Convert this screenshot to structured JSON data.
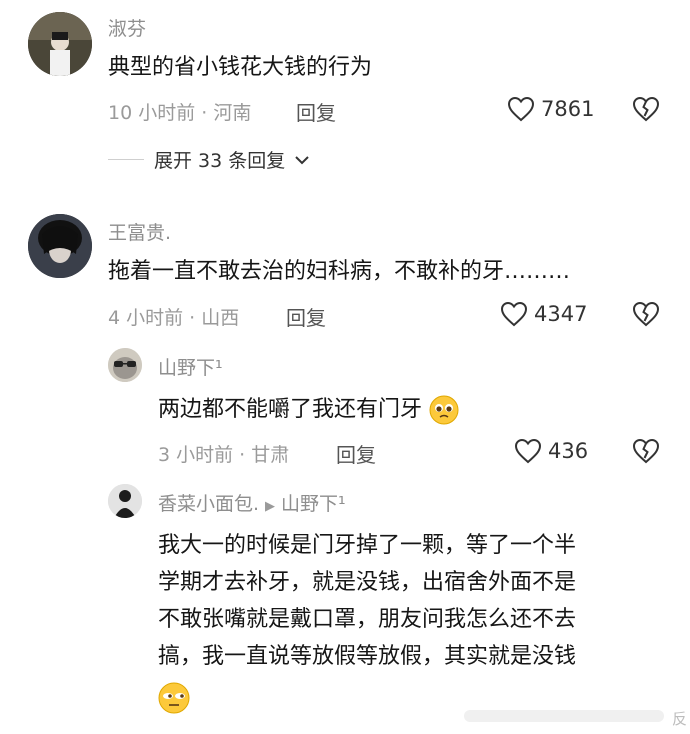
{
  "comments": [
    {
      "username": "淑芬",
      "text": "典型的省小钱花大钱的行为",
      "meta": "10 小时前 · 河南",
      "reply_label": "回复",
      "likes": "7861",
      "expand_label": "展开 33 条回复"
    },
    {
      "username": "王富贵.",
      "text": "拖着一直不敢去治的妇科病，不敢补的牙………",
      "meta": "4 小时前 · 山西",
      "reply_label": "回复",
      "likes": "4347"
    }
  ],
  "replies": [
    {
      "username": "山野下¹",
      "text": "两边都不能嚼了我还有门牙",
      "emoji": "pleading-face",
      "meta": "3 小时前 · 甘肃",
      "reply_label": "回复",
      "likes": "436"
    },
    {
      "username": "香菜小面包.",
      "reply_to": "山野下¹",
      "lines": [
        "我大一的时候是门牙掉了一颗，等了一个半",
        "学期才去补牙，就是没钱，出宿舍外面不是",
        "不敢张嘴就是戴口罩，朋友问我怎么还不去",
        "搞，我一直说等放假等放假，其实就是没钱"
      ],
      "emoji": "unamused-face"
    }
  ],
  "watermark": "反"
}
